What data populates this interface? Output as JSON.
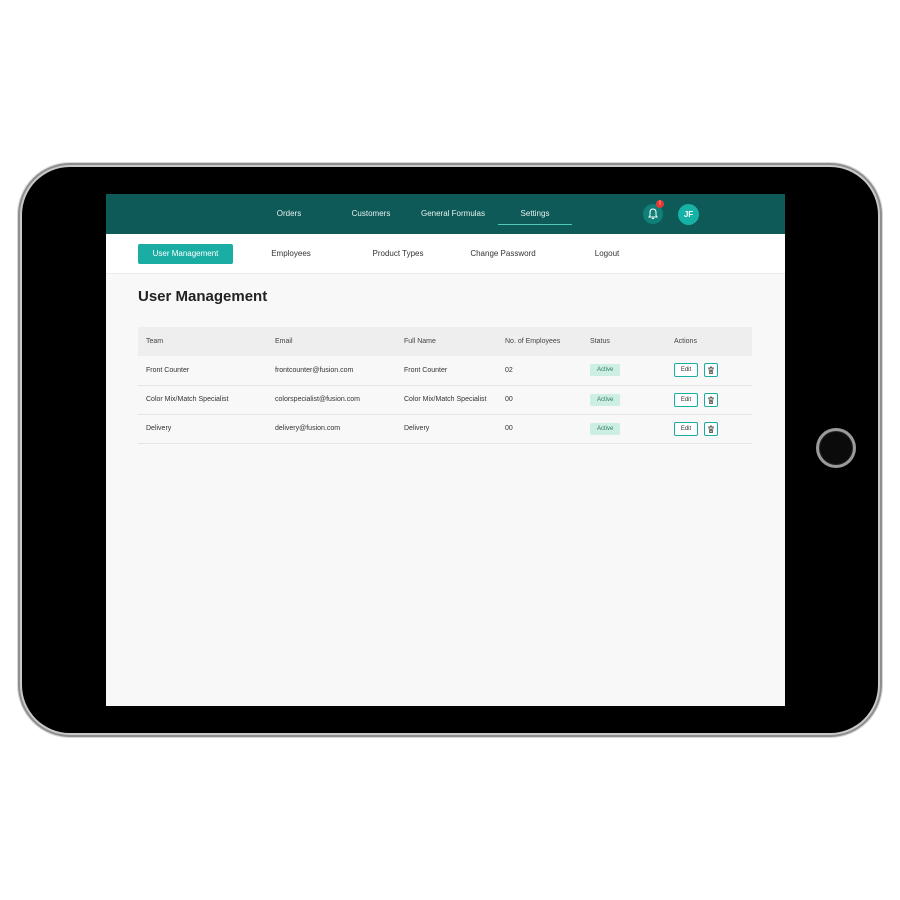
{
  "topnav": {
    "items": [
      {
        "label": "Orders"
      },
      {
        "label": "Customers"
      },
      {
        "label": "General Formulas"
      },
      {
        "label": "Settings"
      }
    ],
    "notification_count": "!",
    "avatar_initials": "JF"
  },
  "subnav": {
    "items": [
      {
        "label": "User Management"
      },
      {
        "label": "Employees"
      },
      {
        "label": "Product Types"
      },
      {
        "label": "Change Password"
      },
      {
        "label": "Logout"
      }
    ]
  },
  "page": {
    "title": "User Management"
  },
  "table": {
    "columns": [
      "Team",
      "Email",
      "Full Name",
      "No. of Employees",
      "Status",
      "Actions"
    ],
    "rows": [
      {
        "team": "Front Counter",
        "email": "frontcounter@fusion.com",
        "full_name": "Front Counter",
        "employees": "02",
        "status": "Active"
      },
      {
        "team": "Color Mix/Match Specialist",
        "email": "colorspecialist@fusion.com",
        "full_name": "Color Mix/Match Specialist",
        "employees": "00",
        "status": "Active"
      },
      {
        "team": "Delivery",
        "email": "delivery@fusion.com",
        "full_name": "Delivery",
        "employees": "00",
        "status": "Active"
      }
    ],
    "edit_label": "Edit"
  },
  "colors": {
    "topbar": "#0e5a58",
    "accent": "#19ada4",
    "status_bg": "#cdeee2"
  },
  "icons": {
    "bell": "bell-icon",
    "delete": "trash-icon"
  }
}
